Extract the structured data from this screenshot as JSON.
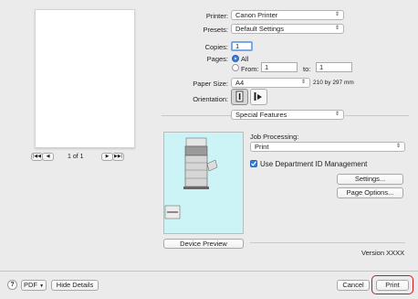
{
  "printer": {
    "label": "Printer:",
    "value": "Canon Printer"
  },
  "presets": {
    "label": "Presets:",
    "value": "Default Settings"
  },
  "copies": {
    "label": "Copies:",
    "value": "1"
  },
  "pages": {
    "label": "Pages:",
    "all": "All",
    "from": "From:",
    "from_value": "1",
    "to": "to:",
    "to_value": "1",
    "selected": "All"
  },
  "paper_size": {
    "label": "Paper Size:",
    "value": "A4",
    "dimensions": "210 by 297 mm"
  },
  "orientation": {
    "label": "Orientation:",
    "selected": "portrait"
  },
  "section_menu": {
    "value": "Special Features"
  },
  "job_processing": {
    "label": "Job Processing:",
    "value": "Print"
  },
  "dept_id": {
    "label": "Use Department ID Management",
    "checked": true
  },
  "buttons": {
    "settings": "Settings...",
    "page_options": "Page Options...",
    "device_preview": "Device Preview",
    "pdf": "PDF",
    "hide_details": "Hide Details",
    "cancel": "Cancel",
    "print": "Print",
    "help": "?"
  },
  "pager": {
    "text": "1 of 1"
  },
  "version": {
    "text": "Version XXXX"
  },
  "colors": {
    "preview_bg": "#ccf3f5",
    "accent": "#3b7ddd",
    "print_highlight": "#d9151b"
  }
}
